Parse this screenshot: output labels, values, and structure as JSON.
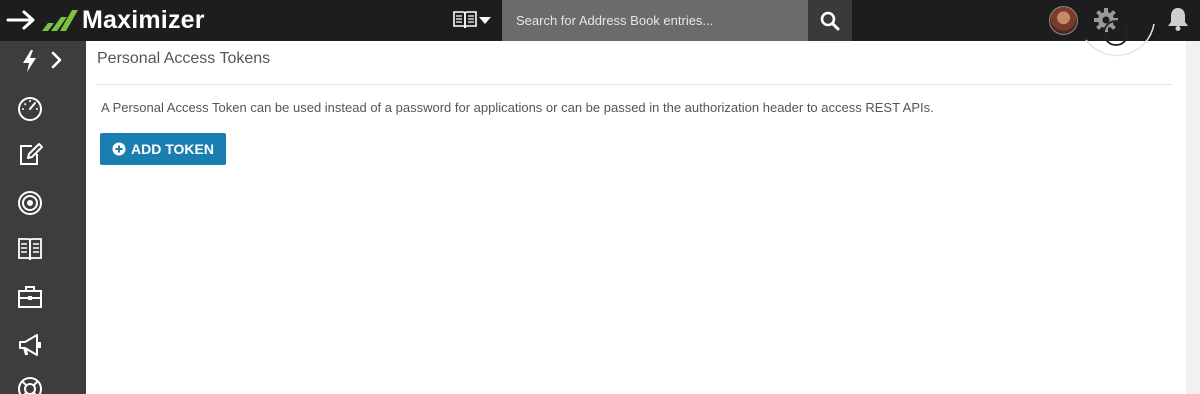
{
  "header": {
    "logo_text": "Maximizer",
    "search": {
      "placeholder": "Search for Address Book entries..."
    },
    "icons": {
      "collapse": "arrow-right-icon",
      "book_switch": "address-book-icon",
      "search": "search-icon",
      "avatar": "user-avatar",
      "settings": "gear-icon",
      "help": "help-icon",
      "notifications": "bell-icon"
    }
  },
  "sidebar": {
    "items": [
      {
        "icon": "lightning-icon"
      },
      {
        "icon": "dashboard-gauge-icon"
      },
      {
        "icon": "edit-note-icon"
      },
      {
        "icon": "target-icon"
      },
      {
        "icon": "address-book-icon"
      },
      {
        "icon": "briefcase-icon"
      },
      {
        "icon": "megaphone-icon"
      },
      {
        "icon": "lifebuoy-icon"
      }
    ],
    "expand_icon": "chevron-right-icon"
  },
  "main": {
    "title": "Personal Access Tokens",
    "description": "A Personal Access Token can be used instead of a password for applications or can be passed in the authorization header to access REST APIs.",
    "add_button_label": "ADD TOKEN"
  },
  "colors": {
    "topbar": "#1d1d1d",
    "sidebar": "#3d3d3d",
    "search_bg": "#6b6b6b",
    "primary_button": "#1a7fb0",
    "logo_green": "#7cc242"
  }
}
